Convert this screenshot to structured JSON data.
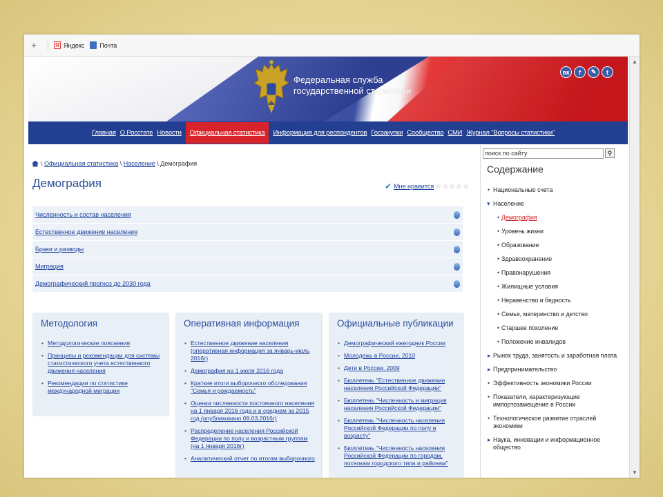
{
  "bookmarks": {
    "plus": "+",
    "items": [
      {
        "label": "Яндекс",
        "icon": "yandex-icon"
      },
      {
        "label": "Почта",
        "icon": "mail-icon"
      }
    ]
  },
  "header": {
    "agency_line1": "Федеральная служба",
    "agency_line2": "государственной статистики",
    "social": [
      "вк",
      "f",
      "✎",
      "t"
    ]
  },
  "nav": {
    "items": [
      "Главная",
      "О Росстате",
      "Новости",
      "Официальная статистика",
      "Информация для респондентов",
      "Госзакупки",
      "Сообщество",
      "СМИ",
      "Журнал \"Вопросы статистики\""
    ],
    "active_index": 3
  },
  "breadcrumb": {
    "sep1": "\\",
    "link1": "Официальная статистика",
    "sep2": "\\",
    "link2": "Население",
    "current": "\\ Демография"
  },
  "page": {
    "title": "Демография",
    "like_label": "Мне нравится",
    "stars": "☆☆☆☆☆"
  },
  "sections": [
    "Численность и состав населения",
    "Естественное движение населения",
    "Браки и разводы",
    "Миграция",
    "Демографический прогноз до 2030 года"
  ],
  "panels": {
    "methodology": {
      "title": "Методология",
      "items": [
        "Методологические пояснения",
        "Принципы и рекомендации для системы статистического учета естественного движения населения",
        "Рекомендации по статистике международной миграции"
      ]
    },
    "operational": {
      "title": "Оперативная информация",
      "items": [
        "Естественное движение населения (оперативная информация за январь-июль 2016г)",
        "Демография на 1 июля 2016 года",
        "Краткие итоги выборочного обследования \"Семья и рождаемость\"",
        "Оценка численности постоянного населения на 1 января 2016 года и в среднем за 2015 год (опубликовано 09.03.2016г)",
        "Распределение населения Российской Федерации по полу и возрастным группам (на 1 января 2016г)",
        "Аналитический отчет по итогам выборочного"
      ]
    },
    "publications": {
      "title": "Официальные публикации",
      "items": [
        "Демографический ежегодник России",
        "Молодежь в России. 2010",
        "Дети в России. 2009",
        "Бюллетень \"Естественное движение населения Российской Федерации\"",
        "Бюллетень \"Численность и миграция населения Российской Федерации\"",
        "Бюллетень \"Численность населения Российской Федерации по полу и возрасту\"",
        "Бюллетень \"Численность населения Российской Федерации по городам, поселкам городского типа и районам\""
      ]
    }
  },
  "sidebar": {
    "search_placeholder": "поиск по сайту",
    "title": "Содержание",
    "items": [
      {
        "label": "Национальные счета",
        "kind": "lvl1"
      },
      {
        "label": "Население",
        "kind": "open"
      },
      {
        "label": "Демография",
        "kind": "lvl2 current"
      },
      {
        "label": "Уровень жизни",
        "kind": "lvl2"
      },
      {
        "label": "Образование",
        "kind": "lvl2"
      },
      {
        "label": "Здравоохранение",
        "kind": "lvl2"
      },
      {
        "label": "Правонарушения",
        "kind": "lvl2"
      },
      {
        "label": "Жилищные условия",
        "kind": "lvl2"
      },
      {
        "label": "Неравенство и бедность",
        "kind": "lvl2"
      },
      {
        "label": "Семья, материнство и детство",
        "kind": "lvl2"
      },
      {
        "label": "Старшее поколение",
        "kind": "lvl2"
      },
      {
        "label": "Положение инвалидов",
        "kind": "lvl2"
      },
      {
        "label": "Рынок труда, занятость и заработная плата",
        "kind": "closed"
      },
      {
        "label": "Предпринимательство",
        "kind": "closed"
      },
      {
        "label": "Эффективность экономики России",
        "kind": "lvl1"
      },
      {
        "label": "Показатели, характеризующие импортозамещение в России",
        "kind": "lvl1"
      },
      {
        "label": "Технологическое развитие отраслей экономики",
        "kind": "lvl1"
      },
      {
        "label": "Наука, инновации и информационное общество",
        "kind": "closed"
      }
    ]
  },
  "colors": {
    "nav_bg": "#233f91",
    "nav_active": "#d8232a",
    "link": "#1a3e9a",
    "heading": "#2a4d9b"
  }
}
